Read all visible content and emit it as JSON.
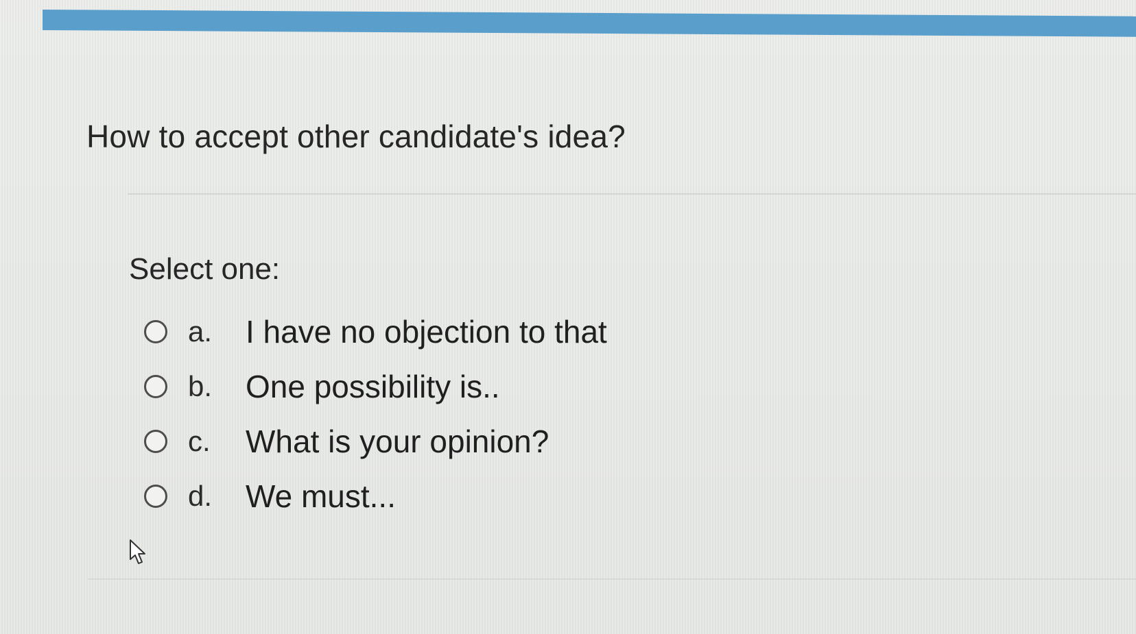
{
  "question": {
    "text": "How to accept other candidate's idea?",
    "prompt": "Select one:"
  },
  "options": [
    {
      "letter": "a.",
      "text": "I have no objection to that",
      "selected": false
    },
    {
      "letter": "b.",
      "text": "One possibility is..",
      "selected": false
    },
    {
      "letter": "c.",
      "text": "What is your opinion?",
      "selected": false
    },
    {
      "letter": "d.",
      "text": "We must...",
      "selected": false
    }
  ],
  "icons": {
    "radio": "radio-button-icon",
    "cursor": "mouse-pointer-icon"
  },
  "colors": {
    "header_bar": "#5a9ecb",
    "background": "#e6e8e5",
    "text": "#262626"
  }
}
